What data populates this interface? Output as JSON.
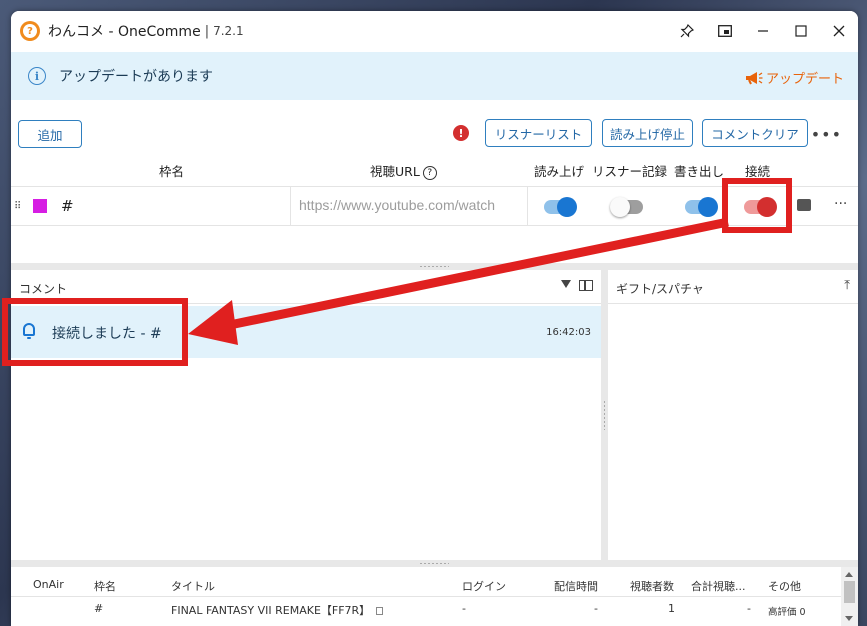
{
  "window": {
    "app_name": "わんコメ - OneComme",
    "separator": "|",
    "version": "7.2.1"
  },
  "update_bar": {
    "message": "アップデートがあります",
    "link_label": "アップデート"
  },
  "toolbar": {
    "add_label": "追加",
    "listener_list_label": "リスナーリスト",
    "stop_reading_label": "読み上げ停止",
    "clear_comments_label": "コメントクリア",
    "alert_symbol": "!"
  },
  "columns": {
    "frame": "枠名",
    "url": "視聴URL",
    "read_aloud": "読み上げ",
    "listener_record": "リスナー記録",
    "export": "書き出し",
    "connect": "接続"
  },
  "frame_row": {
    "name": "#",
    "swatch_color": "#d61ee3",
    "url": "https://www.youtube.com/watch",
    "read_aloud_on": true,
    "listener_record_on": false,
    "export_on": true,
    "connected": true
  },
  "comment_pane": {
    "title": "コメント",
    "items": [
      {
        "text": "接続しました - #",
        "time": "16:42:03"
      }
    ]
  },
  "gift_pane": {
    "title": "ギフト/スパチャ"
  },
  "stats": {
    "headers": [
      "OnAir",
      "枠名",
      "タイトル",
      "ログイン",
      "配信時間",
      "視聴者数",
      "合計視聴...",
      "その他"
    ],
    "rows": [
      {
        "onair": "",
        "frame": "#",
        "title": "FINAL FANTASY VII REMAKE【FF7R】",
        "login": "-",
        "duration": "-",
        "viewers": "1",
        "total": "-",
        "other": "高評価 0"
      }
    ]
  },
  "colors": {
    "accent": "#1976d2",
    "connect_red": "#d32f2f",
    "update_orange": "#e8630a",
    "annotation_red": "#e0201f"
  }
}
